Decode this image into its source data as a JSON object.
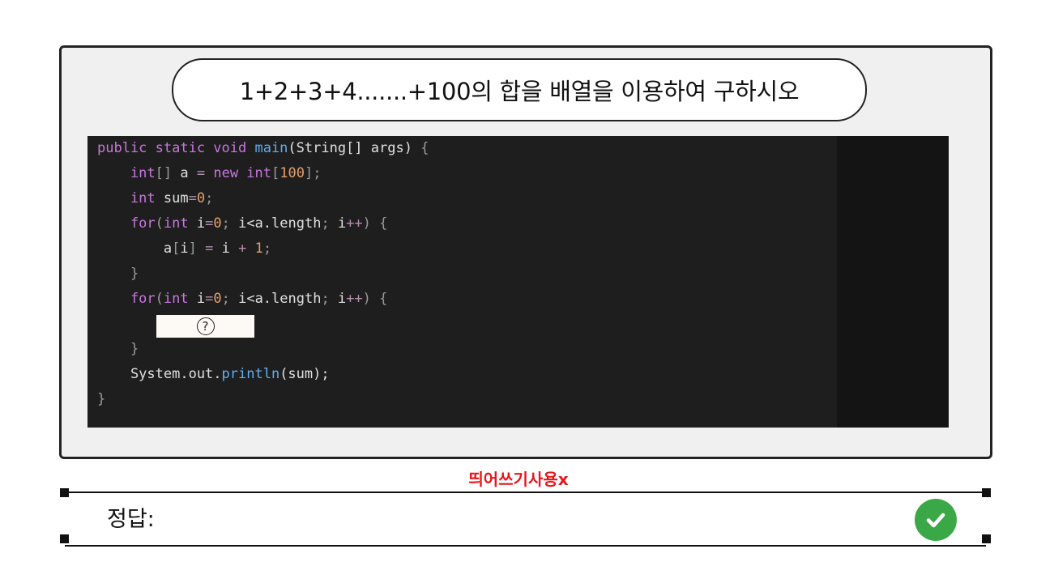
{
  "question": {
    "title": "1+2+3+4.......+100의 합을 배열을 이용하여 구하시오"
  },
  "code": {
    "lines": [
      [
        {
          "t": "public static void ",
          "c": "kw"
        },
        {
          "t": "main",
          "c": "fn"
        },
        {
          "t": "(String[] args) ",
          "c": "pl"
        },
        {
          "t": "{",
          "c": "br"
        }
      ],
      [
        {
          "t": "    int",
          "c": "kw"
        },
        {
          "t": "[] ",
          "c": "br"
        },
        {
          "t": "a ",
          "c": "pl"
        },
        {
          "t": "= ",
          "c": "op"
        },
        {
          "t": "new int",
          "c": "kw"
        },
        {
          "t": "[",
          "c": "br"
        },
        {
          "t": "100",
          "c": "num"
        },
        {
          "t": "];",
          "c": "br"
        }
      ],
      [
        {
          "t": "    int ",
          "c": "kw"
        },
        {
          "t": "sum",
          "c": "pl"
        },
        {
          "t": "=",
          "c": "op"
        },
        {
          "t": "0",
          "c": "num"
        },
        {
          "t": ";",
          "c": "br"
        }
      ],
      [
        {
          "t": "    for",
          "c": "kw"
        },
        {
          "t": "(",
          "c": "br"
        },
        {
          "t": "int ",
          "c": "kw"
        },
        {
          "t": "i",
          "c": "pl"
        },
        {
          "t": "=",
          "c": "op"
        },
        {
          "t": "0",
          "c": "num"
        },
        {
          "t": "; ",
          "c": "br"
        },
        {
          "t": "i<a.length",
          "c": "pl"
        },
        {
          "t": "; ",
          "c": "br"
        },
        {
          "t": "i",
          "c": "pl"
        },
        {
          "t": "++",
          "c": "op"
        },
        {
          "t": ") {",
          "c": "br"
        }
      ],
      [
        {
          "t": "        a",
          "c": "pl"
        },
        {
          "t": "[",
          "c": "br"
        },
        {
          "t": "i",
          "c": "pl"
        },
        {
          "t": "] ",
          "c": "br"
        },
        {
          "t": "= ",
          "c": "op"
        },
        {
          "t": "i ",
          "c": "pl"
        },
        {
          "t": "+ ",
          "c": "op"
        },
        {
          "t": "1",
          "c": "num"
        },
        {
          "t": ";",
          "c": "br"
        }
      ],
      [
        {
          "t": "    }",
          "c": "br"
        }
      ],
      [
        {
          "t": "    for",
          "c": "kw"
        },
        {
          "t": "(",
          "c": "br"
        },
        {
          "t": "int ",
          "c": "kw"
        },
        {
          "t": "i",
          "c": "pl"
        },
        {
          "t": "=",
          "c": "op"
        },
        {
          "t": "0",
          "c": "num"
        },
        {
          "t": "; ",
          "c": "br"
        },
        {
          "t": "i<a.length",
          "c": "pl"
        },
        {
          "t": "; ",
          "c": "br"
        },
        {
          "t": "i",
          "c": "pl"
        },
        {
          "t": "++",
          "c": "op"
        },
        {
          "t": ") {",
          "c": "br"
        }
      ],
      [],
      [
        {
          "t": "    }",
          "c": "br"
        }
      ],
      [
        {
          "t": "    System.out.",
          "c": "pl"
        },
        {
          "t": "println",
          "c": "fn"
        },
        {
          "t": "(sum);",
          "c": "pl"
        }
      ],
      [
        {
          "t": "}",
          "c": "br"
        }
      ]
    ],
    "blank_marker": "?"
  },
  "note": "띄어쓰기사용x",
  "answer": {
    "label": "정답:",
    "value": "",
    "placeholder": ""
  },
  "icons": {
    "submit": "check-circle-icon",
    "blank": "question-circle-icon"
  },
  "colors": {
    "submit_green": "#3aa847",
    "note_red": "#e8161a",
    "code_bg": "#1e1e1e"
  }
}
